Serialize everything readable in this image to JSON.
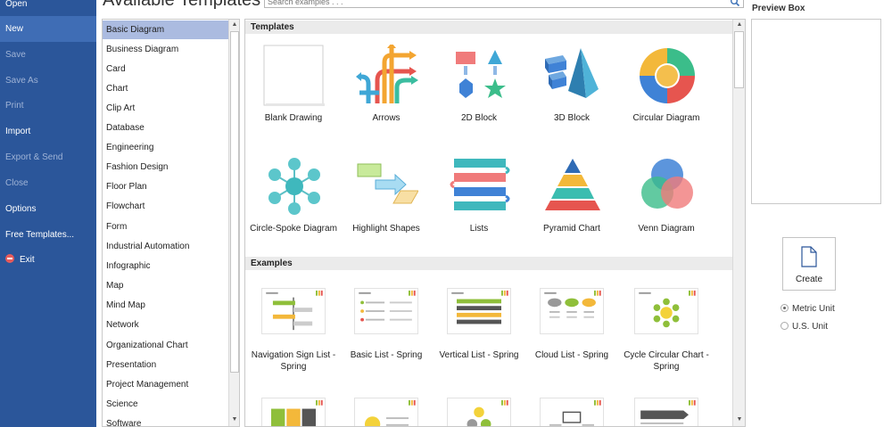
{
  "menu": {
    "items": [
      {
        "label": "Open",
        "state": "normal"
      },
      {
        "label": "New",
        "state": "active"
      },
      {
        "label": "Save",
        "state": "disabled"
      },
      {
        "label": "Save As",
        "state": "disabled"
      },
      {
        "label": "Print",
        "state": "disabled"
      },
      {
        "label": "Import",
        "state": "normal"
      },
      {
        "label": "Export & Send",
        "state": "disabled"
      },
      {
        "label": "Close",
        "state": "disabled"
      },
      {
        "label": "Options",
        "state": "normal"
      },
      {
        "label": "Free Templates...",
        "state": "normal"
      },
      {
        "label": "Exit",
        "state": "normal"
      }
    ]
  },
  "header": {
    "title": "Available Templates",
    "search_placeholder": "Search examples . . ."
  },
  "categories": [
    "Basic Diagram",
    "Business Diagram",
    "Card",
    "Chart",
    "Clip Art",
    "Database",
    "Engineering",
    "Fashion Design",
    "Floor Plan",
    "Flowchart",
    "Form",
    "Industrial Automation",
    "Infographic",
    "Map",
    "Mind Map",
    "Network",
    "Organizational Chart",
    "Presentation",
    "Project Management",
    "Science",
    "Software"
  ],
  "selected_category": "Basic Diagram",
  "templates_section": {
    "title": "Templates",
    "items": [
      {
        "label": "Blank Drawing",
        "icon": "blank-drawing-icon"
      },
      {
        "label": "Arrows",
        "icon": "arrows-icon"
      },
      {
        "label": "2D Block",
        "icon": "2d-block-icon"
      },
      {
        "label": "3D Block",
        "icon": "3d-block-icon"
      },
      {
        "label": "Circular Diagram",
        "icon": "circular-diagram-icon"
      },
      {
        "label": "Circle-Spoke Diagram",
        "icon": "circle-spoke-icon"
      },
      {
        "label": "Highlight Shapes",
        "icon": "highlight-shapes-icon"
      },
      {
        "label": "Lists",
        "icon": "lists-icon"
      },
      {
        "label": "Pyramid Chart",
        "icon": "pyramid-chart-icon"
      },
      {
        "label": "Venn Diagram",
        "icon": "venn-diagram-icon"
      }
    ]
  },
  "examples_section": {
    "title": "Examples",
    "items": [
      {
        "label": "Navigation Sign List - Spring"
      },
      {
        "label": "Basic List - Spring"
      },
      {
        "label": "Vertical List - Spring"
      },
      {
        "label": "Cloud List - Spring"
      },
      {
        "label": "Cycle Circular Chart - Spring"
      }
    ]
  },
  "preview": {
    "title": "Preview Box",
    "create_label": "Create",
    "units": [
      {
        "label": "Metric Unit",
        "checked": true
      },
      {
        "label": "U.S. Unit",
        "checked": false
      }
    ]
  },
  "colors": {
    "menu_bg": "#2b569a",
    "menu_active": "#3f6db5",
    "selected_category": "#abbbe0"
  }
}
